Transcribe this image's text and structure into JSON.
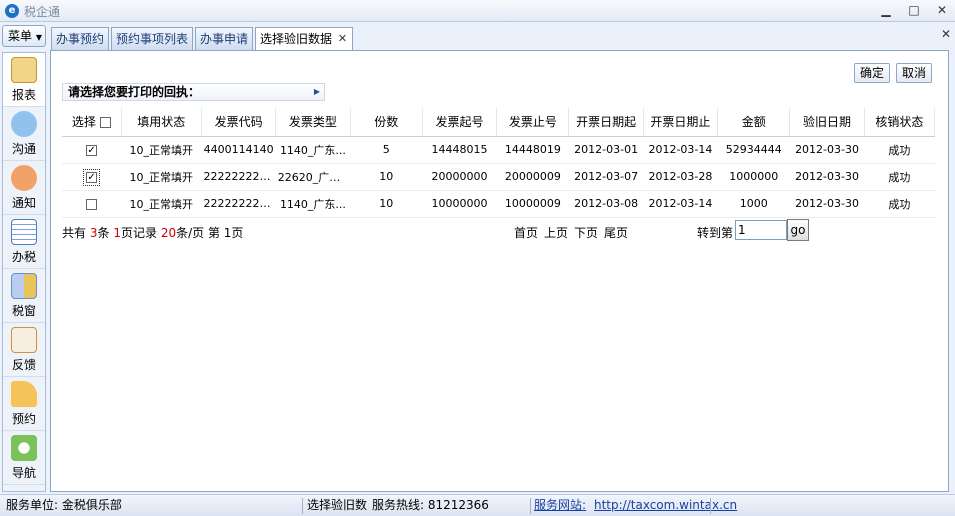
{
  "window": {
    "title": "税企通"
  },
  "menu": {
    "label": "菜单"
  },
  "tabs": [
    {
      "label": "办事预约"
    },
    {
      "label": "预约事项列表"
    },
    {
      "label": "办事申请"
    },
    {
      "label": "选择验旧数据"
    }
  ],
  "sidebar": {
    "items": [
      {
        "label": "报表",
        "icon": "report-icon",
        "color": "#e9b143"
      },
      {
        "label": "沟通",
        "icon": "chat-icon",
        "color": "#3f8fd6"
      },
      {
        "label": "通知",
        "icon": "notice-icon",
        "color": "#e06b2a"
      },
      {
        "label": "办税",
        "icon": "tax-icon",
        "color": "#4c7dc2"
      },
      {
        "label": "税窗",
        "icon": "window-icon",
        "color": "#6b8fd0"
      },
      {
        "label": "反馈",
        "icon": "feedback-icon",
        "color": "#d0913a"
      },
      {
        "label": "预约",
        "icon": "booking-icon",
        "color": "#e8a431"
      },
      {
        "label": "导航",
        "icon": "navigation-icon",
        "color": "#5aa53b"
      }
    ]
  },
  "actions": {
    "confirm": "确定",
    "cancel": "取消"
  },
  "section": {
    "title": "请选择您要打印的回执："
  },
  "table": {
    "headers": [
      "选择",
      "填用状态",
      "发票代码",
      "发票类型",
      "份数",
      "发票起号",
      "发票止号",
      "开票日期起",
      "开票日期止",
      "金额",
      "验旧日期",
      "核销状态"
    ],
    "rows": [
      {
        "checked": true,
        "status": "10_正常填开",
        "code": "4400114140",
        "type": "1140_广东...",
        "count": "5",
        "start": "14448015",
        "end": "14448019",
        "date_from": "2012-03-01",
        "date_to": "2012-03-14",
        "amount": "52934444",
        "check_date": "2012-03-30",
        "result": "成功"
      },
      {
        "checked": true,
        "status": "10_正常填开",
        "code": "2222222222...",
        "type": "22620_广东...",
        "count": "10",
        "start": "20000000",
        "end": "20000009",
        "date_from": "2012-03-07",
        "date_to": "2012-03-28",
        "amount": "1000000",
        "check_date": "2012-03-30",
        "result": "成功"
      },
      {
        "checked": false,
        "status": "10_正常填开",
        "code": "2222222222...",
        "type": "1140_广东...",
        "count": "10",
        "start": "10000000",
        "end": "10000009",
        "date_from": "2012-03-08",
        "date_to": "2012-03-14",
        "amount": "1000",
        "check_date": "2012-03-30",
        "result": "成功"
      }
    ]
  },
  "pager": {
    "prefix": "共有",
    "total": "3",
    "unit1": "条",
    "pages": "1",
    "unit2": "页记录",
    "per_page": "20",
    "unit3": "条/页 第",
    "current": "1",
    "unit4": "页",
    "first": "首页",
    "prev": "上页",
    "next": "下页",
    "last": "尾页",
    "goto_label": "转到第",
    "goto_value": "1",
    "go": "go"
  },
  "status": {
    "unit": "服务单位: 金税俱乐部",
    "current": "选择验旧数",
    "hotline": "服务热线: 81212366",
    "site_label": "服务网站:",
    "site_url": "http://taxcom.wintax.cn"
  }
}
